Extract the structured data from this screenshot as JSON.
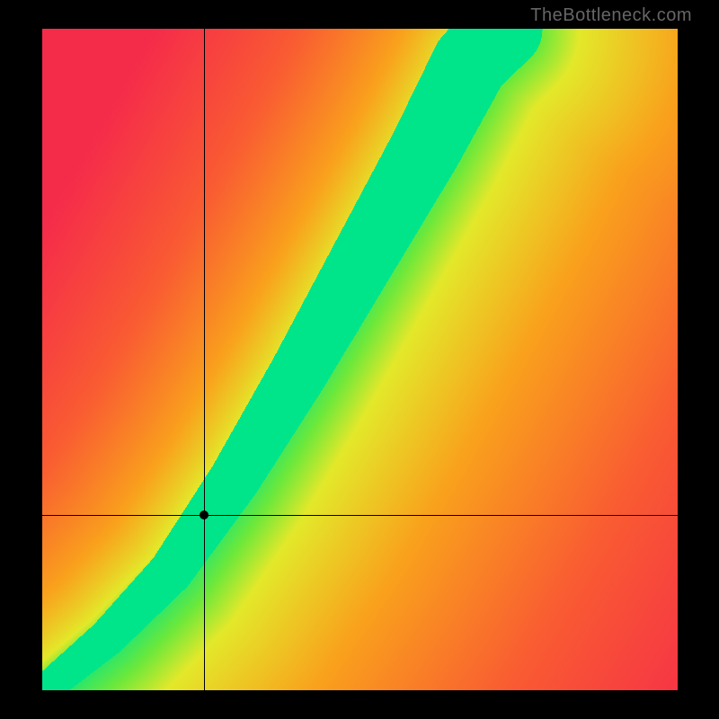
{
  "watermark": "TheBottleneck.com",
  "chart_data": {
    "type": "heatmap",
    "title": "",
    "xlabel": "",
    "ylabel": "",
    "xlim": [
      0,
      100
    ],
    "ylim": [
      0,
      100
    ],
    "crosshair": {
      "x": 25.5,
      "y": 26.5
    },
    "ideal_path": {
      "description": "Green optimal band curving from bottom-left to top-right with increasing slope",
      "points": [
        {
          "x": 0,
          "y": 0
        },
        {
          "x": 10,
          "y": 8
        },
        {
          "x": 20,
          "y": 18
        },
        {
          "x": 30,
          "y": 32
        },
        {
          "x": 40,
          "y": 48
        },
        {
          "x": 50,
          "y": 65
        },
        {
          "x": 60,
          "y": 82
        },
        {
          "x": 67,
          "y": 95
        },
        {
          "x": 72,
          "y": 100
        }
      ],
      "band_width_fraction": 0.06
    },
    "color_stops": [
      {
        "dist": 0.0,
        "color": "#00e58a"
      },
      {
        "dist": 0.08,
        "color": "#6de83a"
      },
      {
        "dist": 0.15,
        "color": "#e3e82a"
      },
      {
        "dist": 0.35,
        "color": "#f9a11c"
      },
      {
        "dist": 0.65,
        "color": "#f95b32"
      },
      {
        "dist": 1.0,
        "color": "#f52b4a"
      }
    ],
    "corner_bias": {
      "top_right_warm": true,
      "bottom_left_cool": false
    }
  }
}
